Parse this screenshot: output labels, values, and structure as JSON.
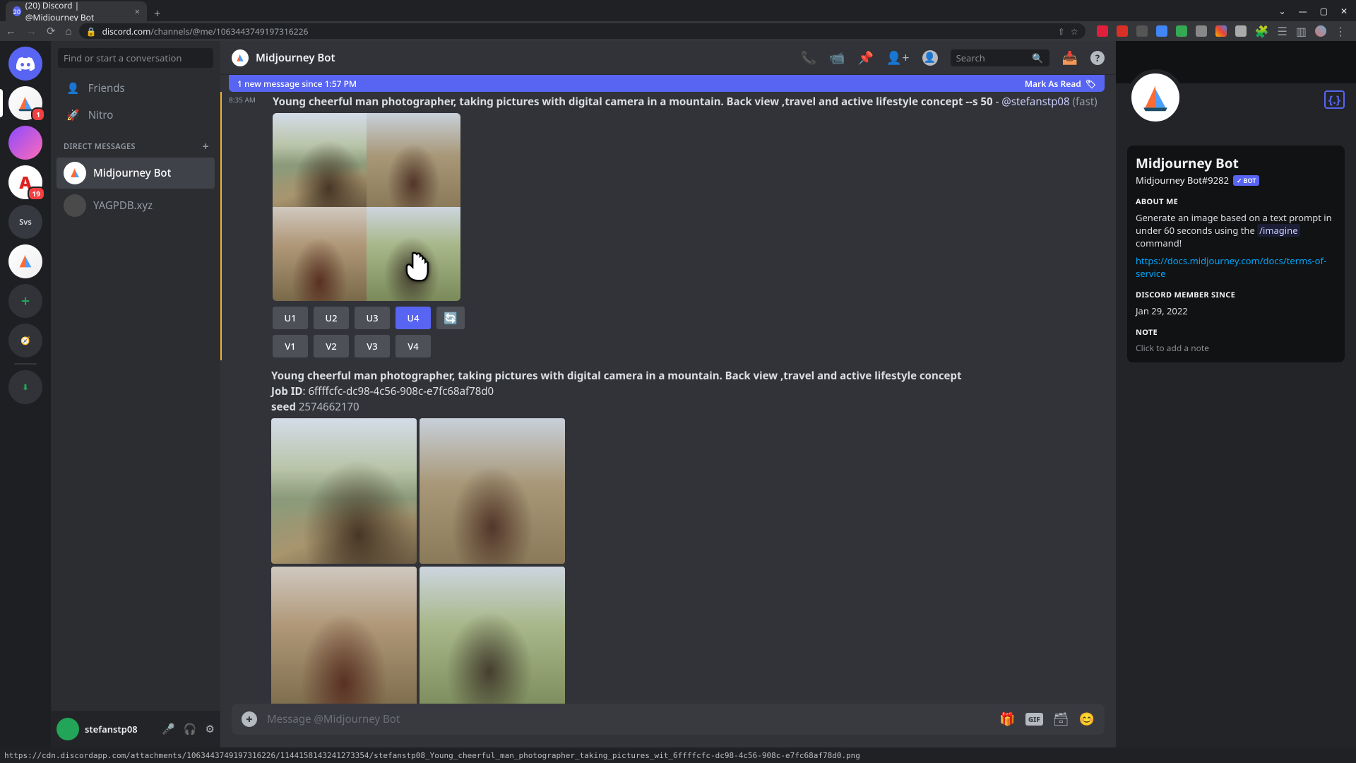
{
  "browser": {
    "tab_title": "(20) Discord | @Midjourney Bot",
    "url_host": "discord.com",
    "url_path": "/channels/@me/1063443749197316226",
    "window_controls": {
      "dropdown": "⌄",
      "min": "—",
      "max": "▢",
      "close": "✕"
    }
  },
  "servers": {
    "unread_badge_1": "1",
    "unread_badge_2": "19",
    "svs_label": "Svs"
  },
  "dm_sidebar": {
    "search_placeholder": "Find or start a conversation",
    "friends_label": "Friends",
    "nitro_label": "Nitro",
    "section_label": "DIRECT MESSAGES",
    "dm1": "Midjourney Bot",
    "dm2": "YAGPDB.xyz"
  },
  "user_panel": {
    "username": "stefanstp08"
  },
  "header": {
    "title": "Midjourney Bot",
    "search_placeholder": "Search"
  },
  "new_message_bar": {
    "text": "1 new message since 1:57 PM",
    "mark_read": "Mark As Read"
  },
  "message1": {
    "time": "8:35 AM",
    "prompt": "Young cheerful man photographer, taking pictures with digital camera in a mountain. Back view ,travel and active lifestyle concept --s 50",
    "separator": " - ",
    "mention": "@stefanstp08",
    "mode": " (fast)",
    "buttons_u": [
      "U1",
      "U2",
      "U3",
      "U4"
    ],
    "refresh": "🔄",
    "buttons_v": [
      "V1",
      "V2",
      "V3",
      "V4"
    ]
  },
  "message2": {
    "prompt": "Young cheerful man photographer, taking pictures with digital camera in a mountain. Back view ,travel and active lifestyle concept",
    "job_label": "Job ID",
    "job_id": ": 6ffffcfc-dc98-4c56-908c-e7fc68af78d0",
    "seed_label": "seed",
    "seed_value": " 2574662170"
  },
  "input": {
    "placeholder": "Message @Midjourney Bot"
  },
  "profile": {
    "name": "Midjourney Bot",
    "tag": "Midjourney Bot#9282",
    "bot_badge": "BOT",
    "about_title": "ABOUT ME",
    "about_text_1": "Generate an image based on a text prompt in under 60 seconds using the ",
    "about_cmd": "/imagine",
    "about_text_2": " command!",
    "about_link": "https://docs.midjourney.com/docs/terms-of-service",
    "member_title": "DISCORD MEMBER SINCE",
    "member_date": "Jan 29, 2022",
    "note_title": "NOTE",
    "note_placeholder": "Click to add a note"
  },
  "status_bar": {
    "url": "https://cdn.discordapp.com/attachments/1063443749197316226/1144158143241273354/stefanstp08_Young_cheerful_man_photographer_taking_pictures_wit_6ffffcfc-dc98-4c56-908c-e7fc68af78d0.png"
  }
}
